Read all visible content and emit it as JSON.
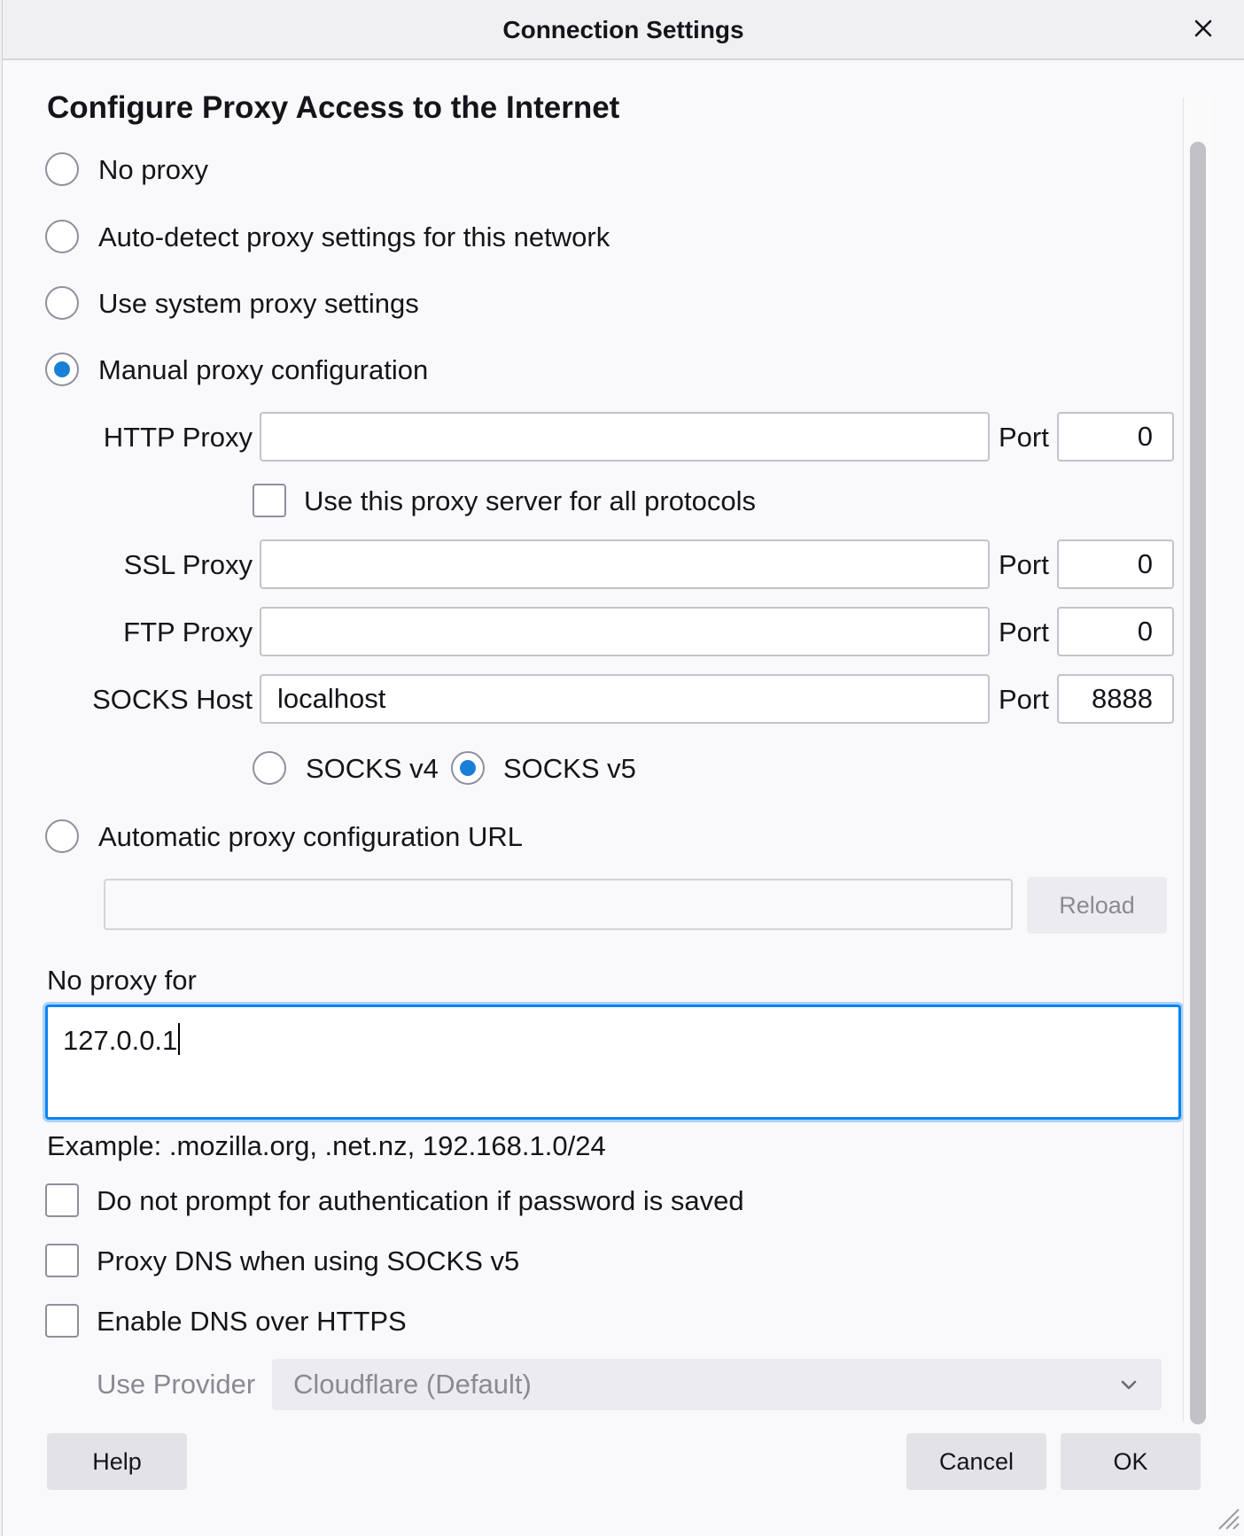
{
  "window": {
    "title": "Connection Settings"
  },
  "heading": "Configure Proxy Access to the Internet",
  "proxy_modes": {
    "no_proxy": {
      "label": "No proxy",
      "checked": false
    },
    "auto_detect": {
      "label": "Auto-detect proxy settings for this network",
      "checked": false
    },
    "system": {
      "label": "Use system proxy settings",
      "checked": false
    },
    "manual": {
      "label": "Manual proxy configuration",
      "checked": true
    },
    "auto_url": {
      "label": "Automatic proxy configuration URL",
      "checked": false
    }
  },
  "manual": {
    "http": {
      "label": "HTTP Proxy",
      "value": "",
      "port_label": "Port",
      "port": "0"
    },
    "use_for_all": {
      "label": "Use this proxy server for all protocols",
      "checked": false
    },
    "ssl": {
      "label": "SSL Proxy",
      "value": "",
      "port_label": "Port",
      "port": "0"
    },
    "ftp": {
      "label": "FTP Proxy",
      "value": "",
      "port_label": "Port",
      "port": "0"
    },
    "socks": {
      "label": "SOCKS Host",
      "value": "localhost",
      "port_label": "Port",
      "port": "8888"
    },
    "socks_v4": {
      "label": "SOCKS v4",
      "checked": false
    },
    "socks_v5": {
      "label": "SOCKS v5",
      "checked": true
    }
  },
  "auto_url": {
    "value": "",
    "reload_label": "Reload"
  },
  "no_proxy_for": {
    "label": "No proxy for",
    "value": "127.0.0.1",
    "example": "Example: .mozilla.org, .net.nz, 192.168.1.0/24"
  },
  "options": {
    "no_auth_prompt": {
      "label": "Do not prompt for authentication if password is saved",
      "checked": false
    },
    "proxy_dns": {
      "label": "Proxy DNS when using SOCKS v5",
      "checked": false
    },
    "dns_over_https": {
      "label": "Enable DNS over HTTPS",
      "checked": false
    }
  },
  "provider": {
    "label": "Use Provider",
    "selected": "Cloudflare (Default)"
  },
  "buttons": {
    "help": "Help",
    "cancel": "Cancel",
    "ok": "OK"
  },
  "colors": {
    "accent": "#1a7fd6",
    "focus_ring": "#0b84ee"
  }
}
